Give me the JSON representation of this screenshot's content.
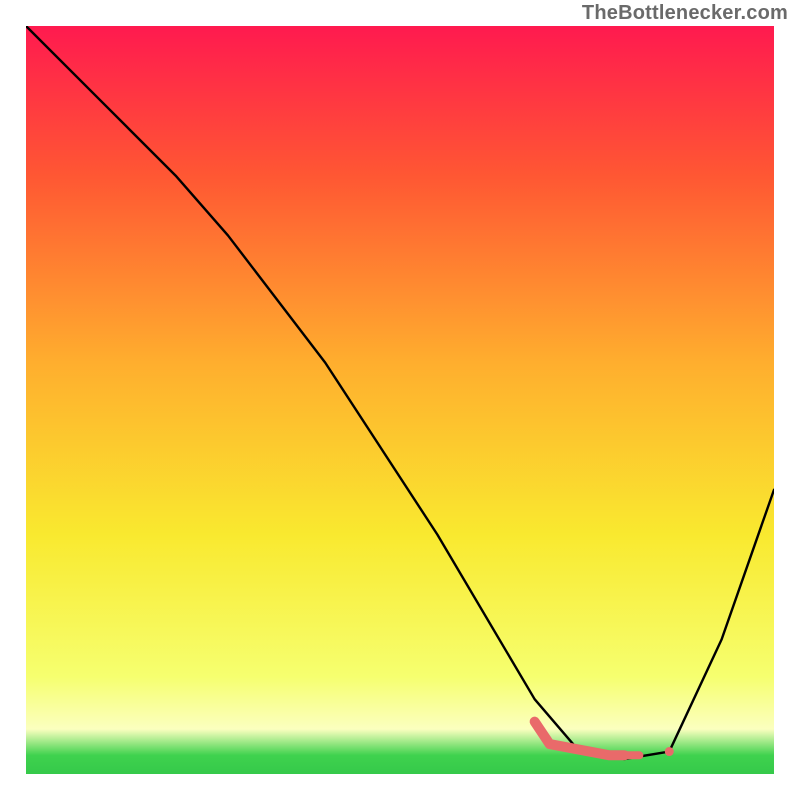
{
  "watermark": "TheBottlenecker.com",
  "chart_data": {
    "type": "line",
    "title": "",
    "xlabel": "",
    "ylabel": "",
    "xlim": [
      0,
      100
    ],
    "ylim": [
      0,
      100
    ],
    "series": [
      {
        "name": "curve",
        "color": "#000000",
        "values": [
          {
            "x": 0,
            "y": 100
          },
          {
            "x": 10,
            "y": 90
          },
          {
            "x": 20,
            "y": 80
          },
          {
            "x": 27,
            "y": 72
          },
          {
            "x": 40,
            "y": 55
          },
          {
            "x": 55,
            "y": 32
          },
          {
            "x": 68,
            "y": 10
          },
          {
            "x": 74,
            "y": 3
          },
          {
            "x": 80,
            "y": 2
          },
          {
            "x": 86,
            "y": 3
          },
          {
            "x": 93,
            "y": 18
          },
          {
            "x": 100,
            "y": 38
          }
        ]
      },
      {
        "name": "bottleneck-markers",
        "color": "#e96a6a",
        "type": "segment",
        "values": [
          {
            "x": 68,
            "y": 7
          },
          {
            "x": 70,
            "y": 4
          },
          {
            "x": 78,
            "y": 2.5
          },
          {
            "x": 80,
            "y": 2.5
          },
          {
            "x": 82,
            "y": 2.5
          },
          {
            "x": 86,
            "y": 3
          }
        ]
      }
    ],
    "background": {
      "type": "gradient",
      "direction": "vertical",
      "stops": [
        {
          "offset": 0.0,
          "color": "#ff1a4f"
        },
        {
          "offset": 0.2,
          "color": "#ff5733"
        },
        {
          "offset": 0.45,
          "color": "#ffae2e"
        },
        {
          "offset": 0.68,
          "color": "#f9e92f"
        },
        {
          "offset": 0.87,
          "color": "#f6ff6f"
        },
        {
          "offset": 0.94,
          "color": "#fbffbf"
        },
        {
          "offset": 0.975,
          "color": "#3fd24e"
        },
        {
          "offset": 1.0,
          "color": "#35c94a"
        }
      ]
    }
  }
}
